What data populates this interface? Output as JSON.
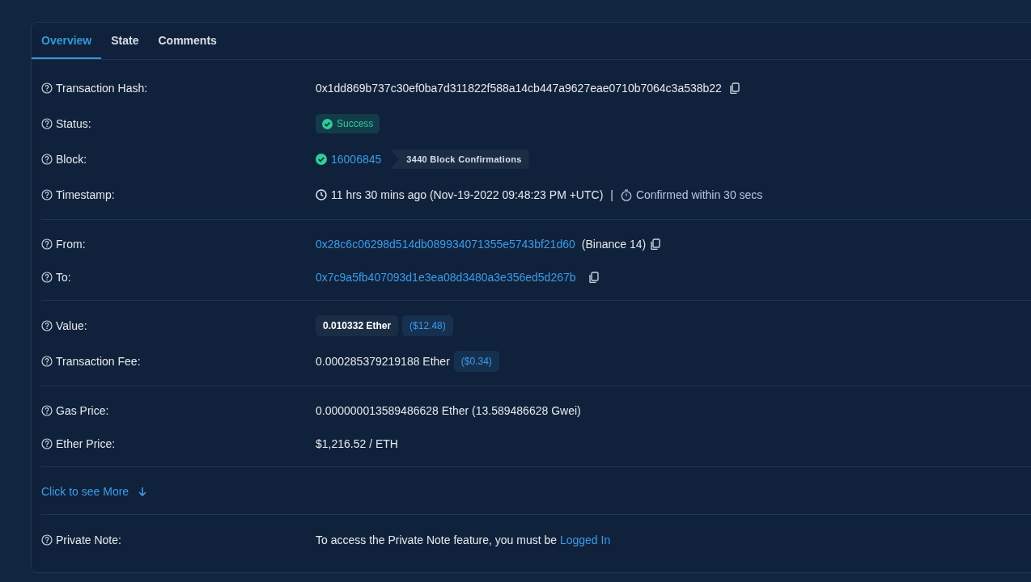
{
  "tabs": [
    {
      "label": "Overview",
      "selected": true
    },
    {
      "label": "State",
      "selected": false
    },
    {
      "label": "Comments",
      "selected": false
    }
  ],
  "sections": [
    {
      "rows": [
        {
          "kind": "hash",
          "label": "Transaction Hash:",
          "value": "0x1dd869b737c30ef0ba7d311822f588a14cb447a9627eae0710b7064c3a538b22"
        },
        {
          "kind": "status",
          "label": "Status:",
          "value": "Success"
        },
        {
          "kind": "block",
          "label": "Block:",
          "value": "16006845",
          "confirmations": "3440 Block Confirmations"
        },
        {
          "kind": "timestamp",
          "label": "Timestamp:",
          "value": "11 hrs 30 mins ago (Nov-19-2022 09:48:23 PM +UTC)",
          "separator": "|",
          "confirmed": "Confirmed within 30 secs"
        }
      ]
    },
    {
      "rows": [
        {
          "kind": "address",
          "label": "From:",
          "value": "0x28c6c06298d514db089934071355e5743bf21d60",
          "name": "(Binance 14)"
        },
        {
          "kind": "address",
          "label": "To:",
          "value": "0x7c9a5fb407093d1e3ea08d3480a3e356ed5d267b"
        }
      ]
    },
    {
      "rows": [
        {
          "kind": "value",
          "label": "Value:",
          "value": "0.010332 Ether",
          "usd": "($12.48)"
        },
        {
          "kind": "fee",
          "label": "Transaction Fee:",
          "value": "0.000285379219188 Ether",
          "usd": "($0.34)"
        }
      ]
    },
    {
      "rows": [
        {
          "kind": "text",
          "label": "Gas Price:",
          "value": "0.000000013589486628 Ether (13.589486628 Gwei)"
        },
        {
          "kind": "text",
          "label": "Ether Price:",
          "value": "$1,216.52 / ETH"
        }
      ]
    }
  ],
  "more_link": "Click to see More",
  "private_note": {
    "label": "Private Note:",
    "text": "To access the Private Note feature, you must be",
    "link": "Logged In"
  }
}
